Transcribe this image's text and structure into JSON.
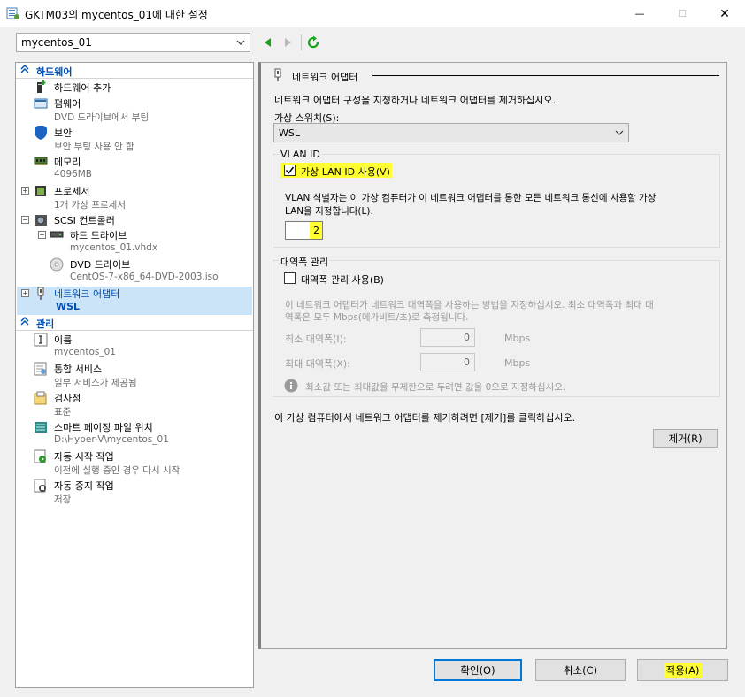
{
  "window": {
    "title": "GKTM03의 mycentos_01에 대한 설정",
    "minimize_glyph": "—",
    "maximize_glyph": "☐",
    "close_glyph": "✕"
  },
  "toolbar": {
    "vm_selected": "mycentos_01",
    "back_icon": "left-arrow-icon",
    "forward_icon": "right-arrow-icon",
    "refresh_icon": "refresh-icon"
  },
  "sidebar": {
    "hardware_header": "하드웨어",
    "management_header": "관리",
    "items": [
      {
        "label": "하드웨어 추가",
        "sub": ""
      },
      {
        "label": "펌웨어",
        "sub": "DVD 드라이브에서 부팅"
      },
      {
        "label": "보안",
        "sub": "보안 부팅 사용 안 함"
      },
      {
        "label": "메모리",
        "sub": "4096MB"
      },
      {
        "label": "프로세서",
        "sub": "1개 가상 프로세서"
      },
      {
        "label": "SCSI 컨트롤러",
        "sub": ""
      },
      {
        "label": "하드 드라이브",
        "sub": "mycentos_01.vhdx"
      },
      {
        "label": "DVD 드라이브",
        "sub": "CentOS-7-x86_64-DVD-2003.iso"
      },
      {
        "label": "네트워크 어댑터",
        "sub": "WSL"
      }
    ],
    "mgmt_items": [
      {
        "label": "이름",
        "sub": "mycentos_01"
      },
      {
        "label": "통합 서비스",
        "sub": "일부 서비스가 제공됨"
      },
      {
        "label": "검사점",
        "sub": "표준"
      },
      {
        "label": "스마트 페이징 파일 위치",
        "sub": "D:\\Hyper-V\\mycentos_01"
      },
      {
        "label": "자동 시작 작업",
        "sub": "이전에 실행 중인 경우 다시 시작"
      },
      {
        "label": "자동 중지 작업",
        "sub": "저장"
      }
    ]
  },
  "panel": {
    "header": "네트워크 어댑터",
    "description": "네트워크 어댑터 구성을 지정하거나 네트워크 어댑터를 제거하십시오.",
    "switch_label": "가상 스위치(S):",
    "switch_value": "WSL",
    "vlan_group": "VLAN ID",
    "vlan_checkbox_label": "가상 LAN ID 사용(V)",
    "vlan_enabled": true,
    "vlan_desc_1": "VLAN 식별자는 이 가상 컴퓨터가 이 네트워크 어댑터를 통한 모든 네트워크 통신에 사용할 가상",
    "vlan_desc_2": "LAN을 지정합니다(L).",
    "vlan_value": "2",
    "bandwidth_group": "대역폭 관리",
    "bandwidth_checkbox_label": "대역폭 관리 사용(B)",
    "bandwidth_enabled": false,
    "bandwidth_desc_1": "이 네트워크 어댑터가 네트워크 대역폭을 사용하는 방법을 지정하십시오. 최소 대역폭과 최대 대",
    "bandwidth_desc_2": "역폭은 모두 Mbps(메가비트/초)로 측정됩니다.",
    "min_label": "최소 대역폭(I):",
    "min_value": "0",
    "max_label": "최대 대역폭(X):",
    "max_value": "0",
    "unit": "Mbps",
    "info_text": "최소값 또는 최대값을 무제한으로 두려면 값을 0으로 지정하십시오.",
    "remove_hint": "이 가상 컴퓨터에서 네트워크 어댑터를 제거하려면 [제거]를 클릭하십시오.",
    "remove_button": "제거(R)"
  },
  "footer": {
    "ok_button": "확인(O)",
    "cancel_button": "취소(C)",
    "apply_button": "적용(A)"
  },
  "colors": {
    "accent_blue": "#0050b4",
    "highlight_yellow": "#ffff32",
    "selection": "#cce4f7",
    "green_nav": "#1aa31a"
  }
}
